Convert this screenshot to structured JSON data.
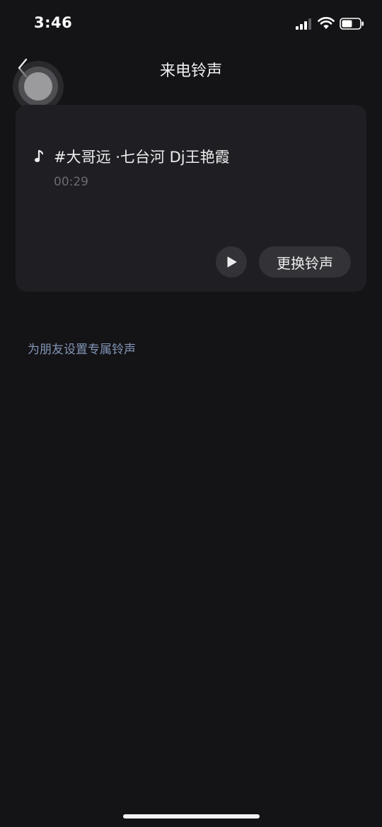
{
  "status_bar": {
    "time": "3:46"
  },
  "nav": {
    "title": "来电铃声"
  },
  "ringtone_card": {
    "song_title": "#大哥远 ·七台河 Dj王艳霞",
    "duration": "00:29",
    "change_label": "更换铃声"
  },
  "friend_link": {
    "label": "为朋友设置专属铃声"
  },
  "colors": {
    "background": "#141316",
    "card": "#1f1e22",
    "button": "#333236",
    "link": "#8195b6"
  },
  "icons": {
    "back": "chevron-left-icon",
    "note": "music-note-icon",
    "play": "play-icon",
    "signal": "signal-icon",
    "wifi": "wifi-icon",
    "battery": "battery-icon"
  }
}
